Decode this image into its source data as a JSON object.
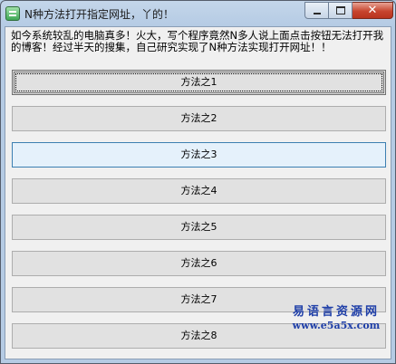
{
  "window": {
    "title": "N种方法打开指定网址，丫的！",
    "controls": {
      "minimize": "minimize",
      "maximize": "maximize",
      "close": "✕"
    }
  },
  "description": "如今系统较乱的电脑真多！火大，写个程序竟然N多人说上面点击按钮无法打开我的博客！经过半天的搜集，自己研究实现了N种方法实现打开网址！！",
  "buttons": [
    {
      "label": "方法之1",
      "state": "default-focused"
    },
    {
      "label": "方法之2",
      "state": "normal"
    },
    {
      "label": "方法之3",
      "state": "hover"
    },
    {
      "label": "方法之4",
      "state": "normal"
    },
    {
      "label": "方法之5",
      "state": "normal"
    },
    {
      "label": "方法之6",
      "state": "normal"
    },
    {
      "label": "方法之7",
      "state": "normal"
    },
    {
      "label": "方法之8",
      "state": "normal"
    }
  ],
  "watermark": {
    "line1": "易语言资源网",
    "line2": "www.e5a5x.com"
  }
}
